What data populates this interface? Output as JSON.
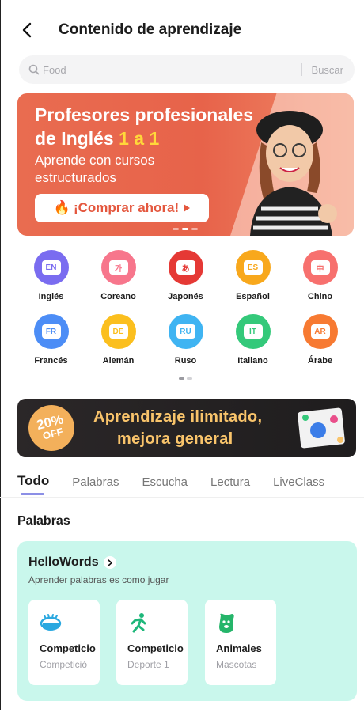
{
  "header": {
    "title": "Contenido de aprendizaje"
  },
  "search": {
    "placeholder": "Food",
    "button": "Buscar"
  },
  "banner": {
    "line1": "Profesores profesionales",
    "line2_prefix": "de Inglés ",
    "line2_highlight": "1 a 1",
    "subtitle": "Aprende con cursos estructurados",
    "cta": "¡Comprar ahora!",
    "page_index": 2,
    "page_count": 3
  },
  "languages": [
    {
      "code": "EN",
      "name": "Inglés",
      "color": "#7a6cf0"
    },
    {
      "code": "가",
      "name": "Coreano",
      "color": "#f7768c"
    },
    {
      "code": "あ",
      "name": "Japonés",
      "color": "#e53935"
    },
    {
      "code": "ES",
      "name": "Español",
      "color": "#f8a81c"
    },
    {
      "code": "中",
      "name": "Chino",
      "color": "#f7706e"
    },
    {
      "code": "FR",
      "name": "Francés",
      "color": "#4c8df6"
    },
    {
      "code": "DE",
      "name": "Alemán",
      "color": "#fbbf1e"
    },
    {
      "code": "RU",
      "name": "Ruso",
      "color": "#3fb4f2"
    },
    {
      "code": "IT",
      "name": "Italiano",
      "color": "#34c97a"
    },
    {
      "code": "AR",
      "name": "Árabe",
      "color": "#f77a32"
    }
  ],
  "promo": {
    "discount": "20%",
    "off": "OFF",
    "line1": "Aprendizaje ilimitado,",
    "line2": "mejora general"
  },
  "tabs": [
    "Todo",
    "Palabras",
    "Escucha",
    "Lectura",
    "LiveClass"
  ],
  "active_tab": "Todo",
  "section": {
    "title": "Palabras"
  },
  "hellowords": {
    "title": "HelloWords",
    "tagline": "Aprender palabras es como jugar",
    "items": [
      {
        "title": "Competicio",
        "subtitle": "Competició",
        "icon": "stadium-icon",
        "color": "#2aa8e0"
      },
      {
        "title": "Competicio",
        "subtitle": "Deporte 1",
        "icon": "runner-icon",
        "color": "#1eb77a"
      },
      {
        "title": "Animales",
        "subtitle": "Mascotas",
        "icon": "dog-icon",
        "color": "#25b56a"
      }
    ]
  }
}
